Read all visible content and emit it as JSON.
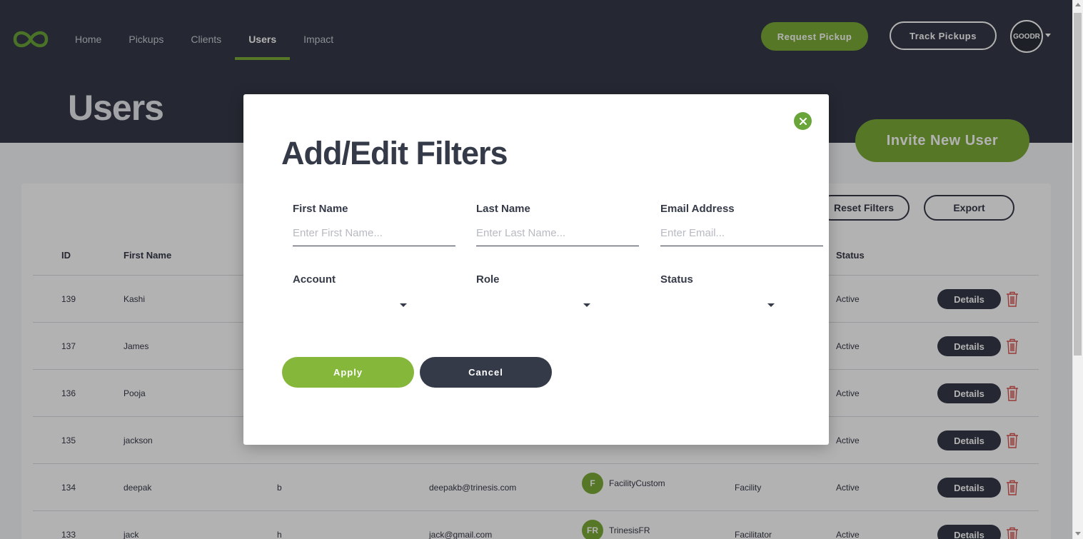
{
  "colors": {
    "navy": "#353a48",
    "green": "#7bab37",
    "danger": "#d9534f"
  },
  "nav": {
    "logo_icon": "goodr-loop-logo",
    "items": [
      {
        "label": "Home",
        "active": false
      },
      {
        "label": "Pickups",
        "active": false
      },
      {
        "label": "Clients",
        "active": false
      },
      {
        "label": "Users",
        "active": true
      },
      {
        "label": "Impact",
        "active": false
      }
    ],
    "request_pickup": "Request Pickup",
    "track_pickups": "Track Pickups",
    "avatar_text": "GOODR"
  },
  "page": {
    "title": "Users",
    "invite_button": "Invite New User"
  },
  "toolbar": {
    "reset_filters": "Reset Filters",
    "export": "Export"
  },
  "table": {
    "headers": {
      "id": "ID",
      "first_name": "First Name",
      "status": "Status"
    },
    "details_label": "Details",
    "rows": [
      {
        "id": "139",
        "first_name": "Kashi",
        "last_name": "",
        "email": "",
        "account_initials": "",
        "account": "",
        "role": "",
        "status": "Active"
      },
      {
        "id": "137",
        "first_name": "James",
        "last_name": "",
        "email": "",
        "account_initials": "",
        "account": "",
        "role": "",
        "status": "Active"
      },
      {
        "id": "136",
        "first_name": "Pooja",
        "last_name": "",
        "email": "",
        "account_initials": "",
        "account": "",
        "role": "",
        "status": "Active"
      },
      {
        "id": "135",
        "first_name": "jackson",
        "last_name": "",
        "email": "",
        "account_initials": "",
        "account": "",
        "role": "",
        "status": "Active"
      },
      {
        "id": "134",
        "first_name": "deepak",
        "last_name": "b",
        "email": "deepakb@trinesis.com",
        "account_initials": "F",
        "account": "FacilityCustom",
        "role": "Facility",
        "status": "Active"
      },
      {
        "id": "133",
        "first_name": "jack",
        "last_name": "h",
        "email": "jack@gmail.com",
        "account_initials": "FR",
        "account": "TrinesisFR",
        "role": "Facilitator",
        "status": "Active"
      }
    ]
  },
  "modal": {
    "title": "Add/Edit Filters",
    "close_icon": "close-icon",
    "fields": {
      "first_name": {
        "label": "First Name",
        "placeholder": "Enter First Name...",
        "value": ""
      },
      "last_name": {
        "label": "Last Name",
        "placeholder": "Enter Last Name...",
        "value": ""
      },
      "email": {
        "label": "Email Address",
        "placeholder": "Enter Email...",
        "value": ""
      },
      "account": {
        "label": "Account",
        "value": ""
      },
      "role": {
        "label": "Role",
        "value": ""
      },
      "status": {
        "label": "Status",
        "value": ""
      }
    },
    "apply": "Apply",
    "cancel": "Cancel"
  }
}
